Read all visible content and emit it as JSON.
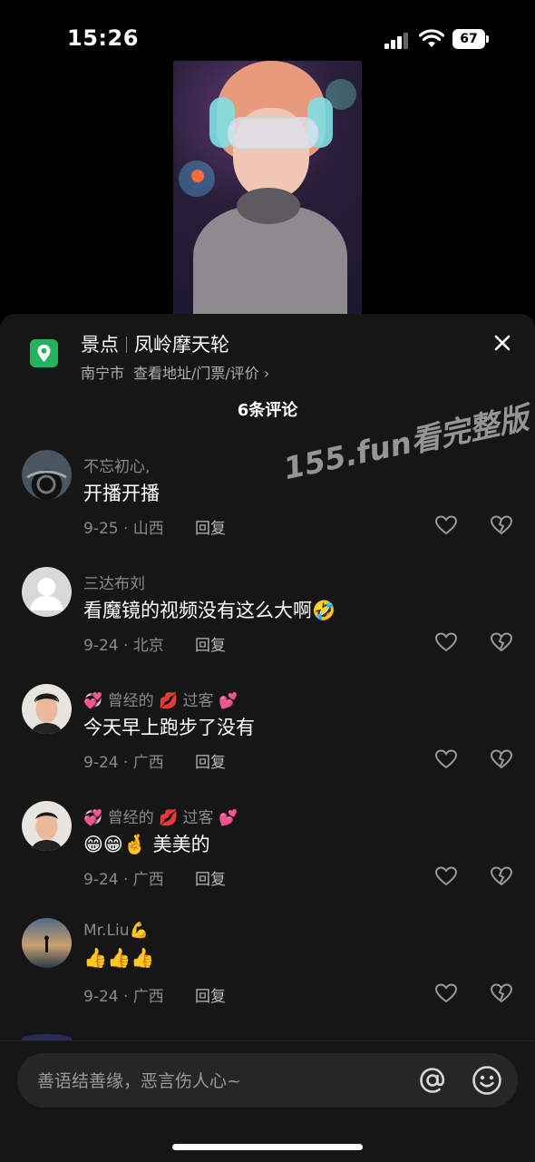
{
  "status_bar": {
    "time": "15:26",
    "battery": "67"
  },
  "location": {
    "category": "景点",
    "name": "凤岭摩天轮",
    "city": "南宁市",
    "link": "查看地址/门票/评价 ›"
  },
  "comment_count": "6条评论",
  "watermark": "155.fun看完整版",
  "comments": [
    {
      "name": "不忘初心,",
      "text": "开播开播",
      "meta": "9-25 · 山西",
      "reply": "回复"
    },
    {
      "name": "三达布刘",
      "text": "看魔镜的视频没有这么大啊🤣",
      "meta": "9-24 · 北京",
      "reply": "回复"
    },
    {
      "name": "💞 曾经的 💋 过客 💕",
      "text": "今天早上跑步了没有",
      "meta": "9-24 · 广西",
      "reply": "回复"
    },
    {
      "name": "💞 曾经的 💋 过客 💕",
      "text": "😁😁🤞 美美的",
      "meta": "9-24 · 广西",
      "reply": "回复"
    },
    {
      "name": "Mr.Liu💪",
      "text": "👍👍👍",
      "meta": "9-24 · 广西",
      "reply": "回复"
    }
  ],
  "input": {
    "placeholder": "善语结善缘，恶言伤人心~"
  },
  "icons": {
    "location": "map-pin-icon",
    "close": "close-icon",
    "like": "heart-icon",
    "dislike": "broken-heart-icon",
    "mention": "at-icon",
    "emoji": "smiley-icon"
  },
  "colors": {
    "accent_green": "#24b35a",
    "sheet_bg": "#161616"
  }
}
